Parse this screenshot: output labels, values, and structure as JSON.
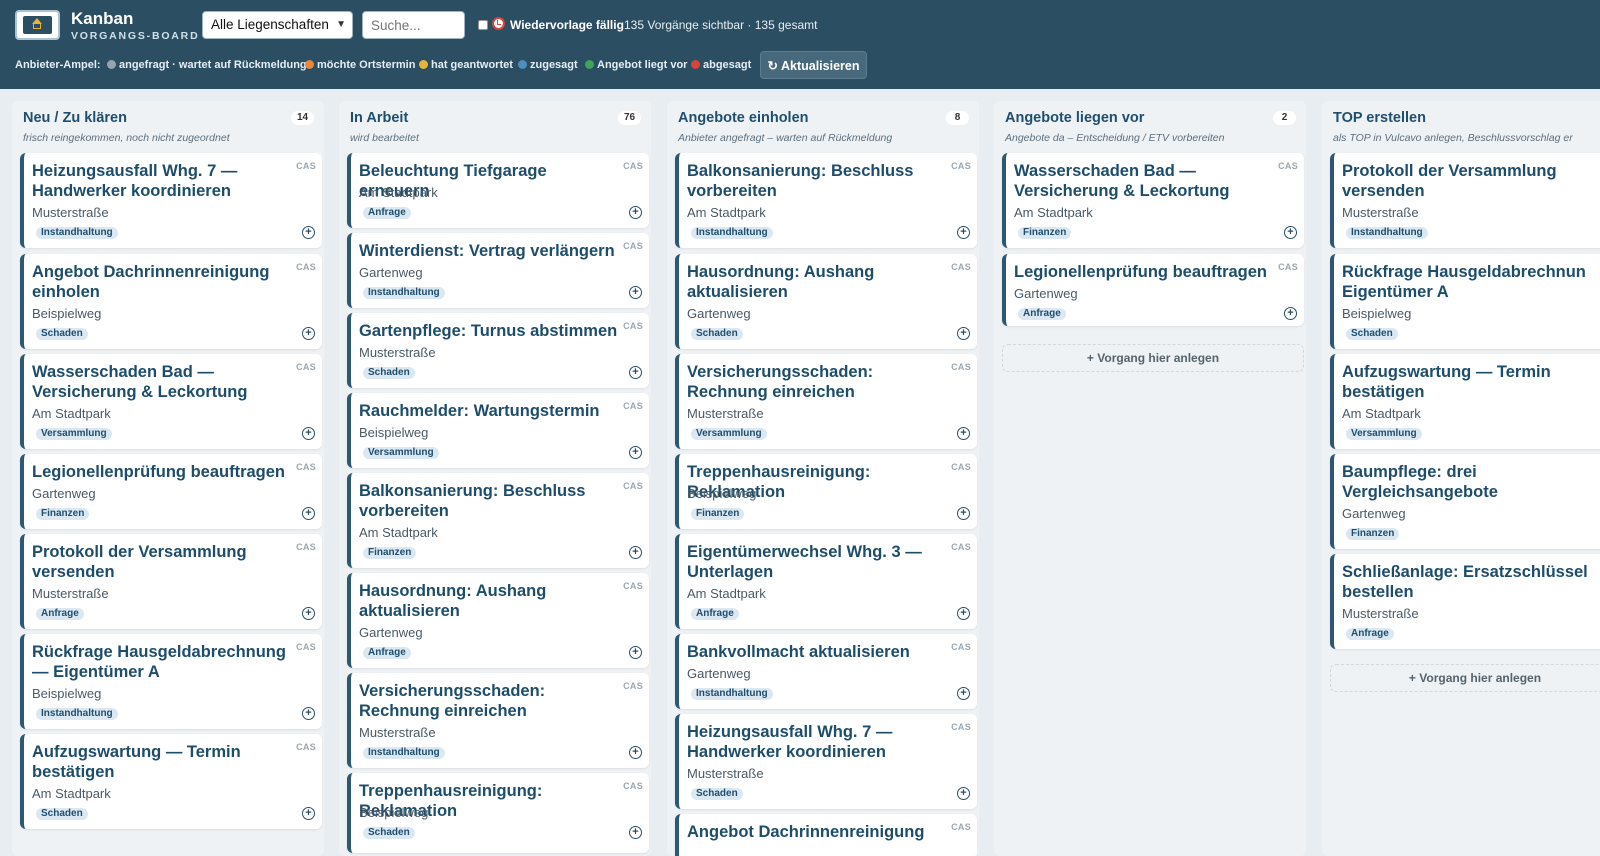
{
  "header": {
    "brand_title": "Kanban",
    "brand_sub": "VORGANGS-BOARD",
    "property_select": "Alle Liegenschaften",
    "search_placeholder": "Suche...",
    "wiedervorlage_label": "Wiedervorlage fällig",
    "count_text": "135 Vorgänge sichtbar · 135 gesamt",
    "legend_label": "Anbieter-Ampel:",
    "legend": [
      {
        "label": "angefragt · wartet auf Rückmeldung",
        "color": "#9aa3ab"
      },
      {
        "label": "möchte Ortstermin",
        "color": "#e8883a"
      },
      {
        "label": "hat geantwortet",
        "color": "#e8b339"
      },
      {
        "label": "zugesagt",
        "color": "#4d8fbf"
      },
      {
        "label": "Angebot liegt vor",
        "color": "#3fa35a"
      },
      {
        "label": "abgesagt",
        "color": "#d9443a"
      }
    ],
    "refresh_label": "↻ Aktualisieren"
  },
  "columns": [
    {
      "title": "Neu / Zu klären",
      "count": "14",
      "subtitle": "frisch reingekommen, noch nicht zugeordnet",
      "cards": [
        {
          "title": "Heizungsausfall Whg. 7 — Handwerker koordinieren",
          "street": "Musterstraße",
          "tag": "Instandhaltung",
          "cas": "CAS"
        },
        {
          "title": "Angebot Dachrinnenreinigung einholen",
          "street": "Beispielweg",
          "tag": "Schaden",
          "cas": "CAS"
        },
        {
          "title": "Wasserschaden Bad — Versicherung & Leckortung",
          "street": "Am Stadtpark",
          "tag": "Versammlung",
          "cas": "CAS"
        },
        {
          "title": "Legionellenprüfung beauftragen",
          "street": "Gartenweg",
          "tag": "Finanzen",
          "cas": "CAS"
        },
        {
          "title": "Protokoll der Versammlung versenden",
          "street": "Musterstraße",
          "tag": "Anfrage",
          "cas": "CAS"
        },
        {
          "title": "Rückfrage Hausgeldabrechnung — Eigentümer A",
          "street": "Beispielweg",
          "tag": "Instandhaltung",
          "cas": "CAS"
        },
        {
          "title": "Aufzugswartung — Termin bestätigen",
          "street": "Am Stadtpark",
          "tag": "Schaden",
          "cas": "CAS"
        }
      ]
    },
    {
      "title": "In Arbeit",
      "count": "76",
      "subtitle": "wird bearbeitet",
      "cards": [
        {
          "title": "Beleuchtung Tiefgarage erneuern",
          "street": "Am Stadtpark",
          "tag": "Anfrage",
          "cas": "CAS"
        },
        {
          "title": "Winterdienst: Vertrag verlängern",
          "street": "Gartenweg",
          "tag": "Instandhaltung",
          "cas": "CAS"
        },
        {
          "title": "Gartenpflege: Turnus abstimmen",
          "street": "Musterstraße",
          "tag": "Schaden",
          "cas": "CAS"
        },
        {
          "title": "Rauchmelder: Wartungstermin",
          "street": "Beispielweg",
          "tag": "Versammlung",
          "cas": "CAS"
        },
        {
          "title": "Balkonsanierung: Beschluss vorbereiten",
          "street": "Am Stadtpark",
          "tag": "Finanzen",
          "cas": "CAS"
        },
        {
          "title": "Hausordnung: Aushang aktualisieren",
          "street": "Gartenweg",
          "tag": "Anfrage",
          "cas": "CAS"
        },
        {
          "title": "Versicherungsschaden: Rechnung einreichen",
          "street": "Musterstraße",
          "tag": "Instandhaltung",
          "cas": "CAS"
        },
        {
          "title": "Treppenhausreinigung: Reklamation",
          "street": "Beispielweg",
          "tag": "Schaden",
          "cas": "CAS"
        }
      ]
    },
    {
      "title": "Angebote einholen",
      "count": "8",
      "subtitle": "Anbieter angefragt – warten auf Rückmeldung",
      "cards": [
        {
          "title": "Balkonsanierung: Beschluss vorbereiten",
          "street": "Am Stadtpark",
          "tag": "Instandhaltung",
          "cas": "CAS"
        },
        {
          "title": "Hausordnung: Aushang aktualisieren",
          "street": "Gartenweg",
          "tag": "Schaden",
          "cas": "CAS"
        },
        {
          "title": "Versicherungsschaden: Rechnung einreichen",
          "street": "Musterstraße",
          "tag": "Versammlung",
          "cas": "CAS"
        },
        {
          "title": "Treppenhausreinigung: Reklamation",
          "street": "Beispielweg",
          "tag": "Finanzen",
          "cas": "CAS"
        },
        {
          "title": "Eigentümerwechsel Whg. 3 — Unterlagen",
          "street": "Am Stadtpark",
          "tag": "Anfrage",
          "cas": "CAS"
        },
        {
          "title": "Bankvollmacht aktualisieren",
          "street": "Gartenweg",
          "tag": "Instandhaltung",
          "cas": "CAS"
        },
        {
          "title": "Heizungsausfall Whg. 7 — Handwerker koordinieren",
          "street": "Musterstraße",
          "tag": "Schaden",
          "cas": "CAS"
        },
        {
          "title": "Angebot Dachrinnenreinigung",
          "street": "",
          "tag": "",
          "cas": "CAS"
        }
      ]
    },
    {
      "title": "Angebote liegen vor",
      "count": "2",
      "subtitle": "Angebote da – Entscheidung / ETV vorbereiten",
      "add_label": "+ Vorgang hier anlegen",
      "cards": [
        {
          "title": "Wasserschaden Bad — Versicherung & Leckortung",
          "street": "Am Stadtpark",
          "tag": "Finanzen",
          "cas": "CAS"
        },
        {
          "title": "Legionellenprüfung beauftragen",
          "street": "Gartenweg",
          "tag": "Anfrage",
          "cas": "CAS"
        }
      ]
    },
    {
      "title": "TOP erstellen",
      "count": "",
      "subtitle": "als TOP in Vulcavo anlegen, Beschlussvorschlag er",
      "add_label": "+ Vorgang hier anlegen",
      "cards": [
        {
          "title": "Protokoll der Versammlung versenden",
          "street": "Musterstraße",
          "tag": "Instandhaltung",
          "cas": ""
        },
        {
          "title": "Rückfrage Hausgeldabrechnun Eigentümer A",
          "street": "Beispielweg",
          "tag": "Schaden",
          "cas": ""
        },
        {
          "title": "Aufzugswartung — Termin bestätigen",
          "street": "Am Stadtpark",
          "tag": "Versammlung",
          "cas": ""
        },
        {
          "title": "Baumpflege: drei Vergleichsangebote",
          "street": "Gartenweg",
          "tag": "Finanzen",
          "cas": ""
        },
        {
          "title": "Schließanlage: Ersatzschlüssel bestellen",
          "street": "Musterstraße",
          "tag": "Anfrage",
          "cas": ""
        }
      ]
    }
  ]
}
